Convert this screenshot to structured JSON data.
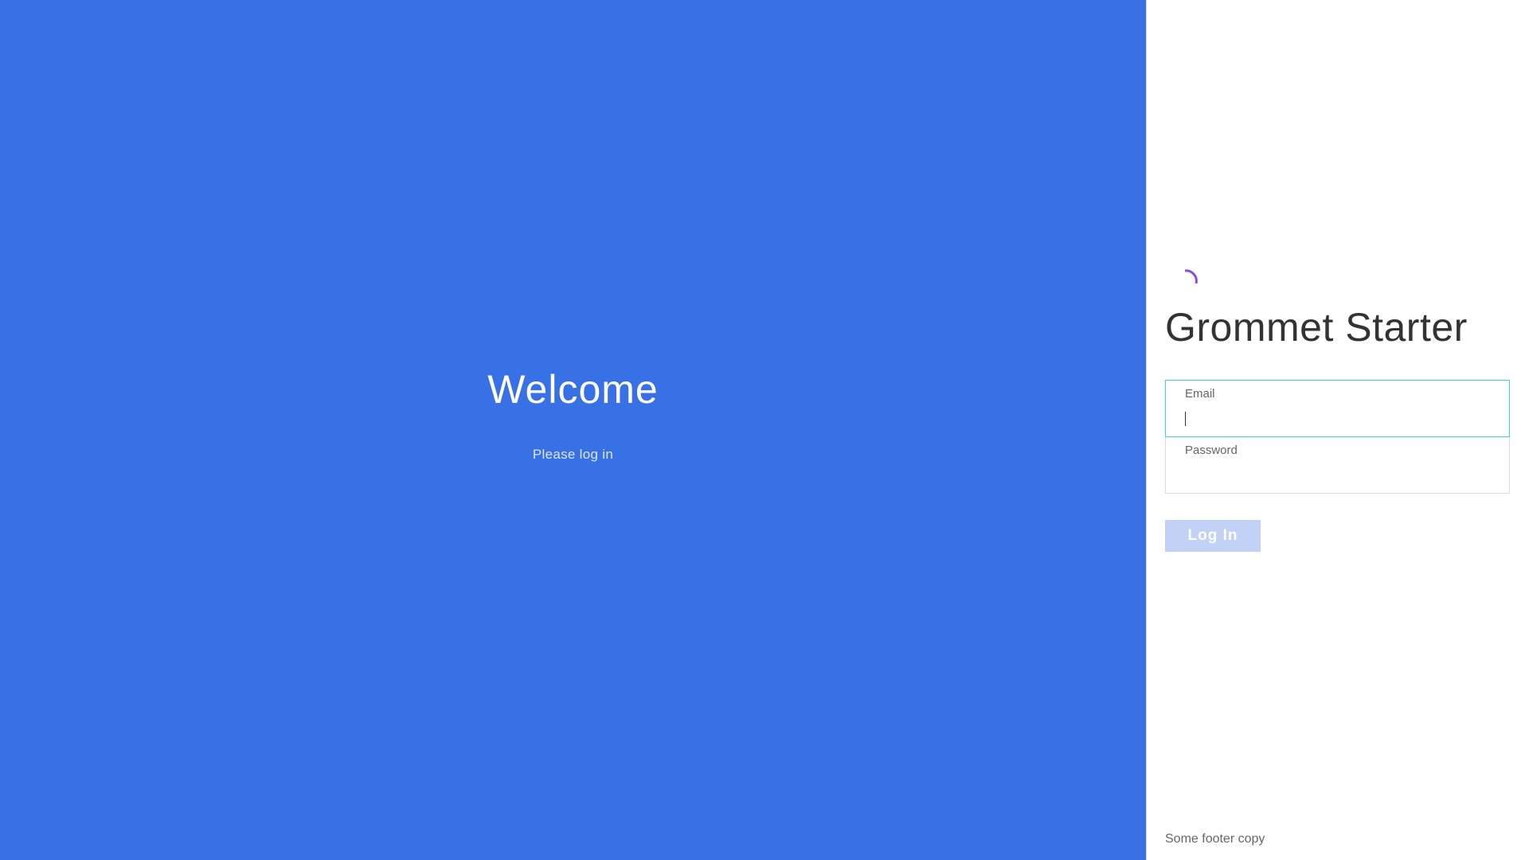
{
  "hero": {
    "title": "Welcome",
    "subtitle": "Please log in",
    "background_color": "#3871e6"
  },
  "app": {
    "title": "Grommet Starter",
    "spinner_icon": "loading-spinner-icon",
    "spinner_color": "#8a4fd8"
  },
  "form": {
    "email": {
      "label": "Email",
      "value": "",
      "focused": true,
      "focus_color": "#3fd6c8"
    },
    "password": {
      "label": "Password",
      "value": ""
    },
    "submit_label": "Log In",
    "submit_disabled": true
  },
  "footer": {
    "text": "Some footer copy"
  }
}
